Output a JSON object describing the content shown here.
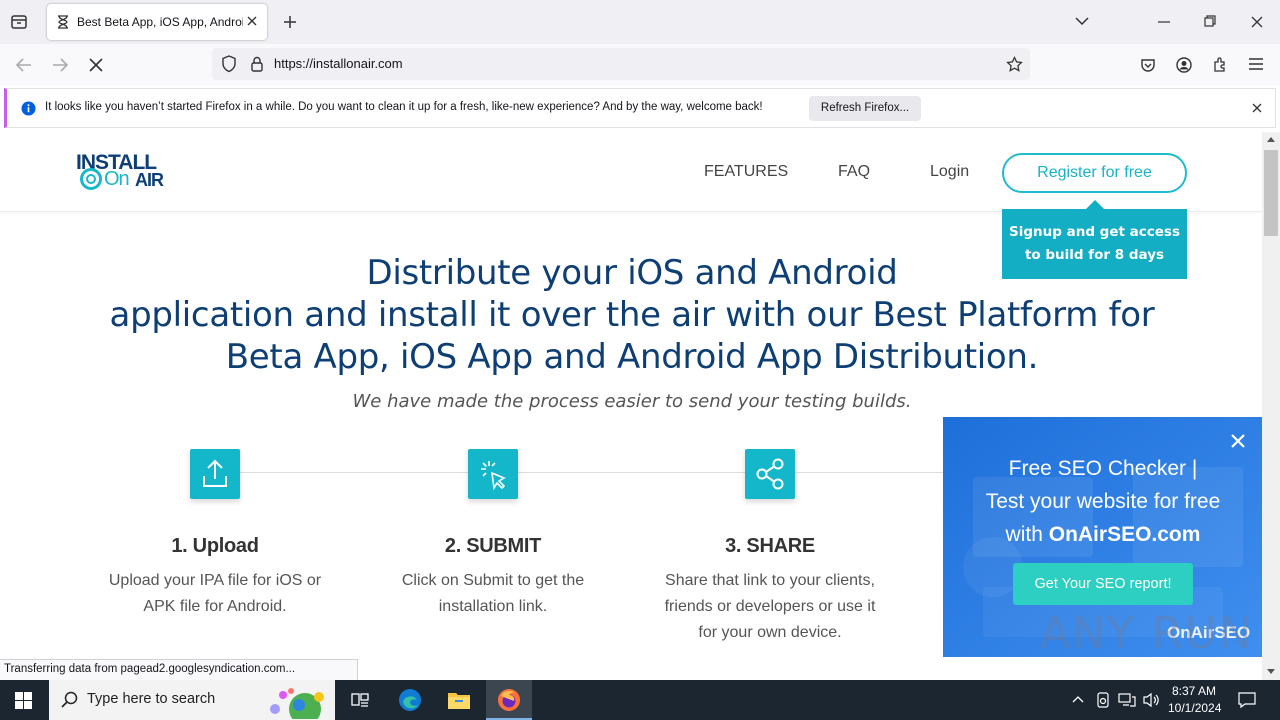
{
  "browser": {
    "tab_title": "Best Beta App, iOS App, Android",
    "url": "https://installonair.com",
    "notification": "It looks like you haven’t started Firefox in a while. Do you want to clean it up for a fresh, like-new experience? And by the way, welcome back!",
    "refresh_label": "Refresh Firefox...",
    "status_text": "Transferring data from pagead2.googlesyndication.com..."
  },
  "site": {
    "logo_top": "INSTALL",
    "logo_bottom_a": "On",
    "logo_bottom_b": "AIR",
    "nav": {
      "features": "FEATURES",
      "faq": "FAQ",
      "login": "Login",
      "register": "Register for free"
    },
    "tooltip_line1": "Signup and get access",
    "tooltip_line2": "to build for 8 days",
    "hero_line1": "Distribute your iOS and Android",
    "hero_line2": "application and install it over the air with our Best Platform for",
    "hero_line3": "Beta App, iOS App and Android App Distribution.",
    "hero_sub": "We have made the process easier to send your testing builds.",
    "steps": [
      {
        "title": "1. Upload",
        "desc_line1": "Upload your IPA file for iOS or",
        "desc_line2": "APK file for Android.",
        "desc_line3": ""
      },
      {
        "title": "2. SUBMIT",
        "desc_line1": "Click on Submit to get the",
        "desc_line2": "installation link.",
        "desc_line3": ""
      },
      {
        "title": "3. SHARE",
        "desc_line1": "Share that link to your clients,",
        "desc_line2": "friends or developers or use it",
        "desc_line3": "for your own device."
      }
    ]
  },
  "ad": {
    "line1": "Free SEO Checker |",
    "line2": "Test your website for free",
    "line3_prefix": "with ",
    "line3_brand": "OnAirSEO.com",
    "button": "Get Your SEO report!",
    "brand": "OnAirSEO"
  },
  "watermark": "ANY RUN",
  "taskbar": {
    "search_placeholder": "Type here to search",
    "time": "8:37 AM",
    "date": "10/1/2024"
  }
}
